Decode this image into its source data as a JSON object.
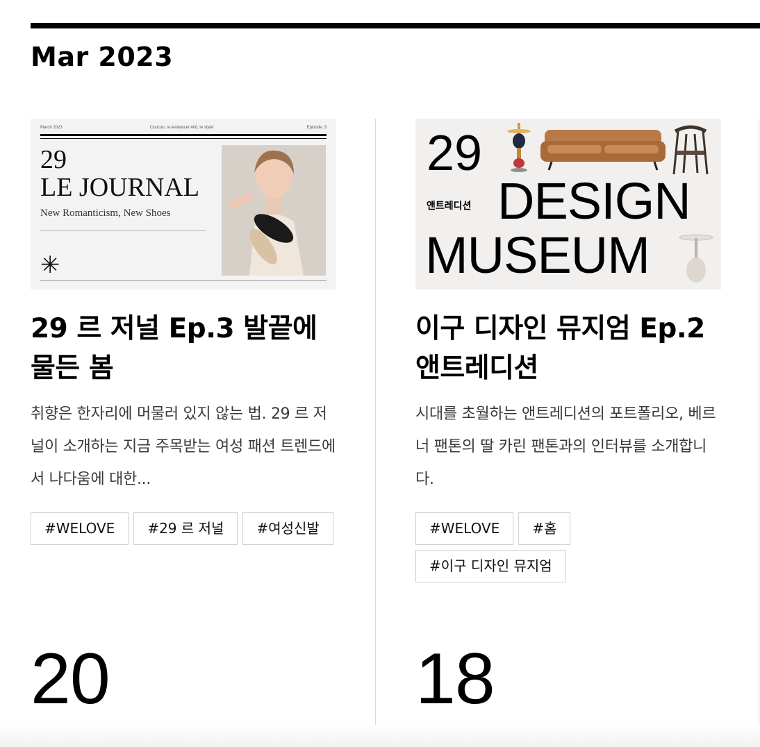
{
  "section": {
    "month": "Mar 2023"
  },
  "cards": [
    {
      "title": "29 르 저널 Ep.3 발끝에 물든 봄",
      "description": "취향은 한자리에 머물러 있지 않는 법. 29 르 저널이 소개하는 지금 주목받는 여성 패션 트렌드에서 나다움에 대한...",
      "tags": [
        "#WELOVE",
        "#29 르 저널",
        "#여성신발"
      ],
      "day": "20",
      "thumbnail": {
        "header_left": "March 2023",
        "header_center": "Coucou, la tendance! Allô, le style!",
        "header_right": "Episode. 3",
        "number": "29",
        "headline": "LE JOURNAL",
        "subline": "New Romanticism, New Shoes",
        "mark": "✳"
      }
    },
    {
      "title": "이구 디자인 뮤지엄 Ep.2 앤트레디션",
      "description": "시대를 초월하는 앤트레디션의 포트폴리오, 베르너 팬톤의 딸 카린 팬톤과의 인터뷰를 소개합니다.",
      "tags": [
        "#WELOVE",
        "#홈",
        "#이구 디자인 뮤지엄"
      ],
      "day": "18",
      "thumbnail": {
        "number": "29",
        "brand": "앤트레디션",
        "line1": "DESIGN",
        "line2": "MUSEUM"
      }
    }
  ],
  "colors": {
    "rule": "#000000",
    "divider": "#d8d8d8",
    "tag_border": "#cfcfcf",
    "sofa": "#b97a47"
  }
}
